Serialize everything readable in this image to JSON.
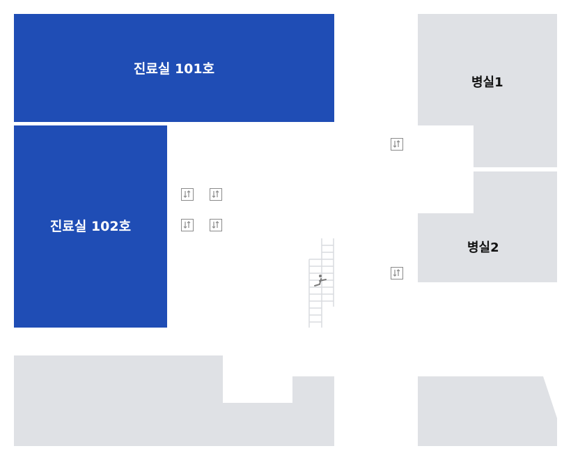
{
  "colors": {
    "active_room": "#1f4db5",
    "inactive_room": "#dfe1e5",
    "icon": "#8a8a8a"
  },
  "rooms": {
    "exam_101": {
      "label": "진료실 101호"
    },
    "exam_102": {
      "label": "진료실 102호"
    },
    "ward_1": {
      "label": "병실1"
    },
    "ward_2": {
      "label": "병실2"
    }
  },
  "icons": {
    "elevator": "elevator-icon",
    "stairs": "stairs-icon",
    "escalator_person": "escalator-person-icon"
  }
}
